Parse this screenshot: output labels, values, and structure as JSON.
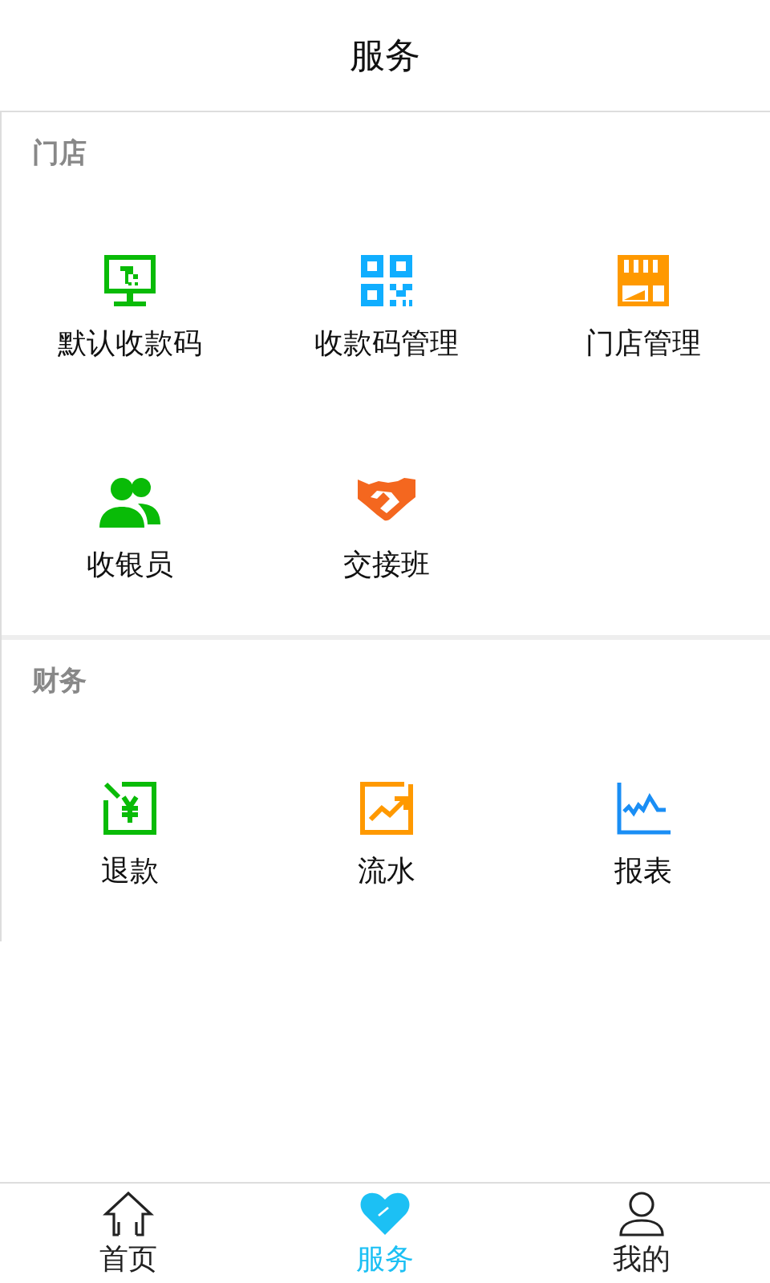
{
  "header": {
    "title": "服务"
  },
  "sections": [
    {
      "title": "门店",
      "items": [
        {
          "label": "默认收款码",
          "kind": "monitor",
          "color": "#09bb07"
        },
        {
          "label": "收款码管理",
          "kind": "qrcode",
          "color": "#10aeff"
        },
        {
          "label": "门店管理",
          "kind": "store",
          "color": "#ff9900"
        },
        {
          "label": "收银员",
          "kind": "people",
          "color": "#09bb07"
        },
        {
          "label": "交接班",
          "kind": "handshake",
          "color": "#f4671f"
        }
      ]
    },
    {
      "title": "财务",
      "items": [
        {
          "label": "退款",
          "kind": "refund",
          "color": "#09bb07"
        },
        {
          "label": "流水",
          "kind": "trend",
          "color": "#ff9900"
        },
        {
          "label": "报表",
          "kind": "linechart",
          "color": "#1a8ef5"
        }
      ]
    }
  ],
  "tabbar": [
    {
      "label": "首页",
      "kind": "home",
      "selected": false
    },
    {
      "label": "服务",
      "kind": "heart",
      "selected": true
    },
    {
      "label": "我的",
      "kind": "person",
      "selected": false
    }
  ]
}
